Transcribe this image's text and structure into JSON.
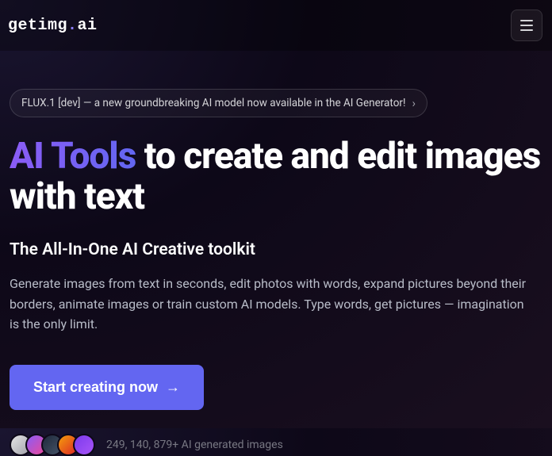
{
  "header": {
    "logo_prefix": "getimg",
    "logo_dot": ".",
    "logo_suffix": "ai"
  },
  "announcement": {
    "text": "FLUX.1 [dev] — a new groundbreaking AI model now available in the AI Generator!"
  },
  "hero": {
    "title_highlight": "AI Tools",
    "title_rest": " to create and edit images with text",
    "subtitle": "The All-In-One AI Creative toolkit",
    "description": "Generate images from text in seconds, edit photos with words, expand pictures beyond their borders, animate images or train custom AI models. Type words, get pictures — imagination is the only limit."
  },
  "cta": {
    "label": "Start creating now"
  },
  "stats": {
    "text": "249, 140, 879+ AI generated images"
  }
}
